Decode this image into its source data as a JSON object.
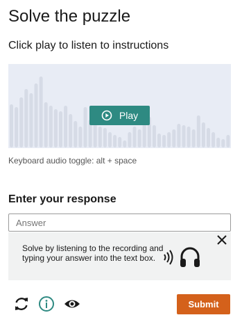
{
  "page": {
    "title": "Solve the puzzle",
    "instructions": "Click play to listen to instructions"
  },
  "audio": {
    "play_label": "Play",
    "keyboard_hint": "Keyboard audio toggle: alt + space",
    "bar_color": "#d6dbe6",
    "panel_color": "#e8ecf5"
  },
  "response": {
    "heading": "Enter your response",
    "placeholder": "Answer"
  },
  "help": {
    "text": "Solve by listening to the recording and typing your answer into the text box.",
    "icons": [
      "close-icon",
      "sound-waves-icon",
      "headphones-icon"
    ]
  },
  "toolbar": {
    "icons": [
      "reload-icon",
      "info-icon",
      "eye-icon"
    ],
    "submit_label": "Submit"
  },
  "colors": {
    "play_button": "#2e8a82",
    "submit_button": "#d4611b",
    "info_icon": "#2e8a82"
  }
}
